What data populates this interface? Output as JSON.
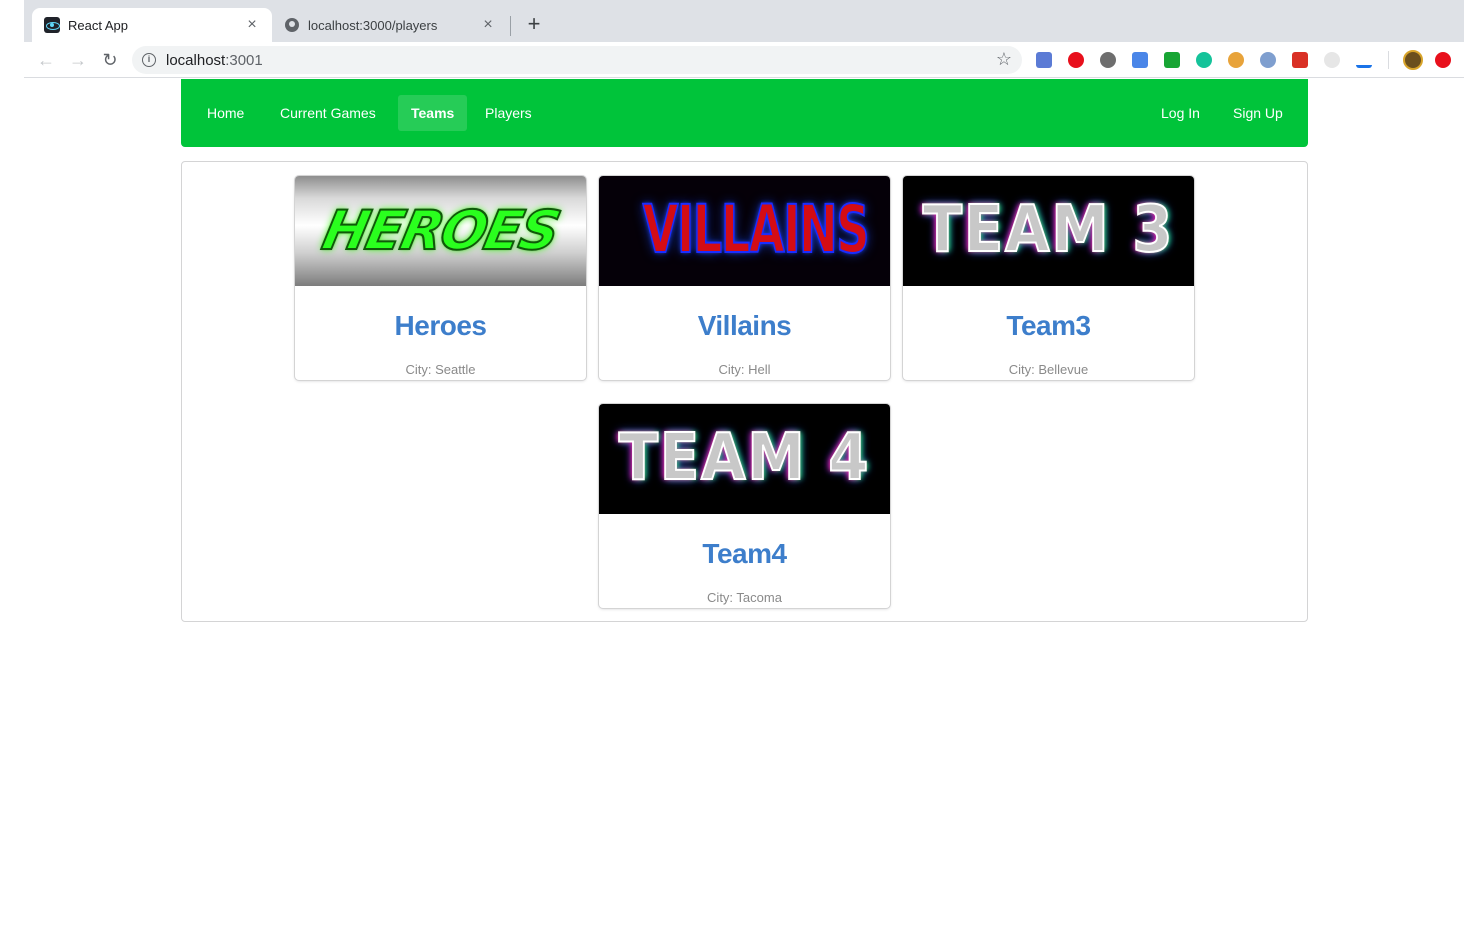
{
  "browser": {
    "tabs": [
      {
        "title": "React App",
        "active": true
      },
      {
        "title": "localhost:3000/players",
        "active": false
      }
    ],
    "url": {
      "host": "localhost",
      "port": ":3001"
    }
  },
  "nav": {
    "left": [
      {
        "label": "Home"
      },
      {
        "label": "Current Games"
      },
      {
        "label": "Teams",
        "active": true
      },
      {
        "label": "Players"
      }
    ],
    "right": [
      {
        "label": "Log In"
      },
      {
        "label": "Sign Up"
      }
    ],
    "color": "#00c43a"
  },
  "teams": [
    {
      "image_text": "HEROES",
      "name": "Heroes",
      "city": "City: Seattle"
    },
    {
      "image_text": "VILLAINS",
      "name": "Villains",
      "city": "City: Hell"
    },
    {
      "image_text": "TEAM 3",
      "name": "Team3",
      "city": "City: Bellevue"
    },
    {
      "image_text": "TEAM 4",
      "name": "Team4",
      "city": "City: Tacoma"
    }
  ],
  "theme": {
    "link_color": "#3d7ecb",
    "muted_text": "#8a8a8a"
  }
}
